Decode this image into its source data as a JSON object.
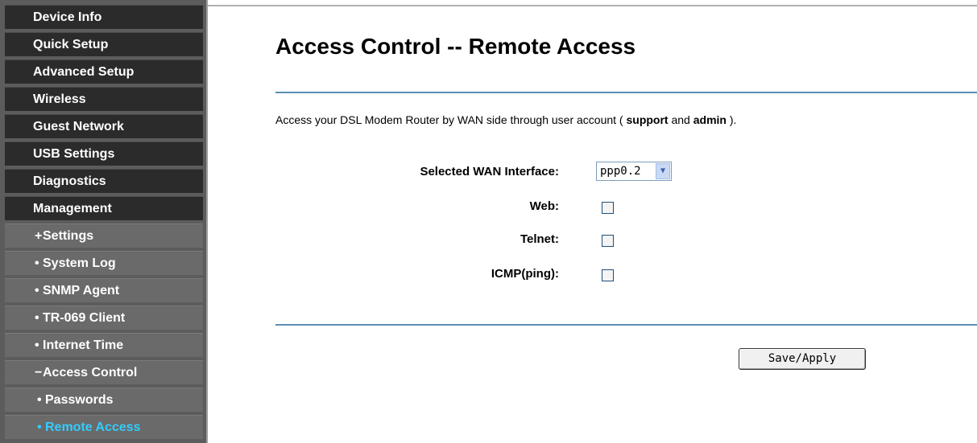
{
  "sidebar": {
    "items": [
      {
        "label": "Device Info",
        "kind": "main"
      },
      {
        "label": "Quick Setup",
        "kind": "main"
      },
      {
        "label": "Advanced Setup",
        "kind": "main"
      },
      {
        "label": "Wireless",
        "kind": "main"
      },
      {
        "label": "Guest Network",
        "kind": "main"
      },
      {
        "label": "USB Settings",
        "kind": "main"
      },
      {
        "label": "Diagnostics",
        "kind": "main"
      },
      {
        "label": "Management",
        "kind": "main"
      },
      {
        "label": "Settings",
        "bullet": "+",
        "kind": "sub"
      },
      {
        "label": "System Log",
        "bullet": "•",
        "kind": "sub"
      },
      {
        "label": "SNMP Agent",
        "bullet": "•",
        "kind": "sub"
      },
      {
        "label": "TR-069 Client",
        "bullet": "•",
        "kind": "sub"
      },
      {
        "label": "Internet Time",
        "bullet": "•",
        "kind": "sub"
      },
      {
        "label": "Access Control",
        "bullet": "−",
        "kind": "sub"
      },
      {
        "label": "Passwords",
        "bullet": "•",
        "kind": "sub2"
      },
      {
        "label": "Remote Access",
        "bullet": "•",
        "kind": "sub2",
        "active": true
      }
    ]
  },
  "main": {
    "title": "Access Control -- Remote Access",
    "description": {
      "prefix": "Access your DSL Modem Router by WAN side through user account ( ",
      "account1": "support",
      "middle": " and ",
      "account2": "admin",
      "suffix": " )."
    },
    "form": {
      "wan_label": "Selected WAN Interface:",
      "wan_value": "ppp0.2",
      "web_label": "Web:",
      "web_checked": false,
      "telnet_label": "Telnet:",
      "telnet_checked": false,
      "icmp_label": "ICMP(ping):",
      "icmp_checked": false
    },
    "save_button": "Save/Apply"
  },
  "colors": {
    "sidebar_bg": "#5c5c5c",
    "main_item_bg": "#2b2b2b",
    "sub_item_bg": "#6a6a6a",
    "active_text": "#33ccff",
    "divider": "#5c8eb4"
  }
}
